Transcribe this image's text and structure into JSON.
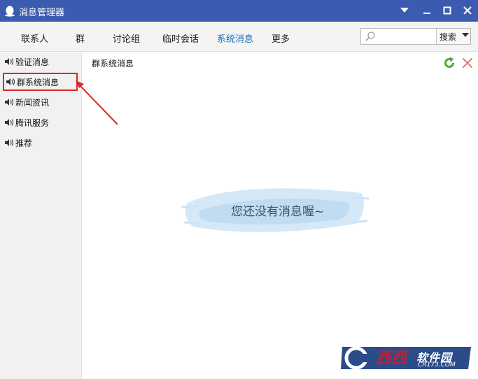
{
  "window": {
    "title": "消息管理器",
    "controls": [
      "chevron-down-icon",
      "minimize-icon",
      "maximize-icon",
      "close-icon"
    ]
  },
  "tabs": [
    {
      "label": "联系人",
      "active": false
    },
    {
      "label": "群",
      "active": false
    },
    {
      "label": "讨论组",
      "active": false
    },
    {
      "label": "临时会话",
      "active": false
    },
    {
      "label": "系统消息",
      "active": true
    },
    {
      "label": "更多",
      "active": false
    }
  ],
  "search": {
    "value": "",
    "placeholder": "",
    "button_label": "搜索"
  },
  "sidebar": {
    "items": [
      {
        "label": "验证消息",
        "selected": false
      },
      {
        "label": "群系统消息",
        "selected": true
      },
      {
        "label": "新闻资讯",
        "selected": false
      },
      {
        "label": "腾讯服务",
        "selected": false
      },
      {
        "label": "推荐",
        "selected": false
      }
    ]
  },
  "content": {
    "title": "群系统消息",
    "empty_message": "您还没有消息喔~"
  },
  "watermark": {
    "main": "西西",
    "side": "软件园",
    "url": "CR173.COM"
  },
  "colors": {
    "titlebar": "#3a5bb0",
    "active_tab": "#1a6fc0",
    "highlight_box": "#d9292c",
    "refresh": "#4caa2e",
    "delete": "#e08080"
  }
}
